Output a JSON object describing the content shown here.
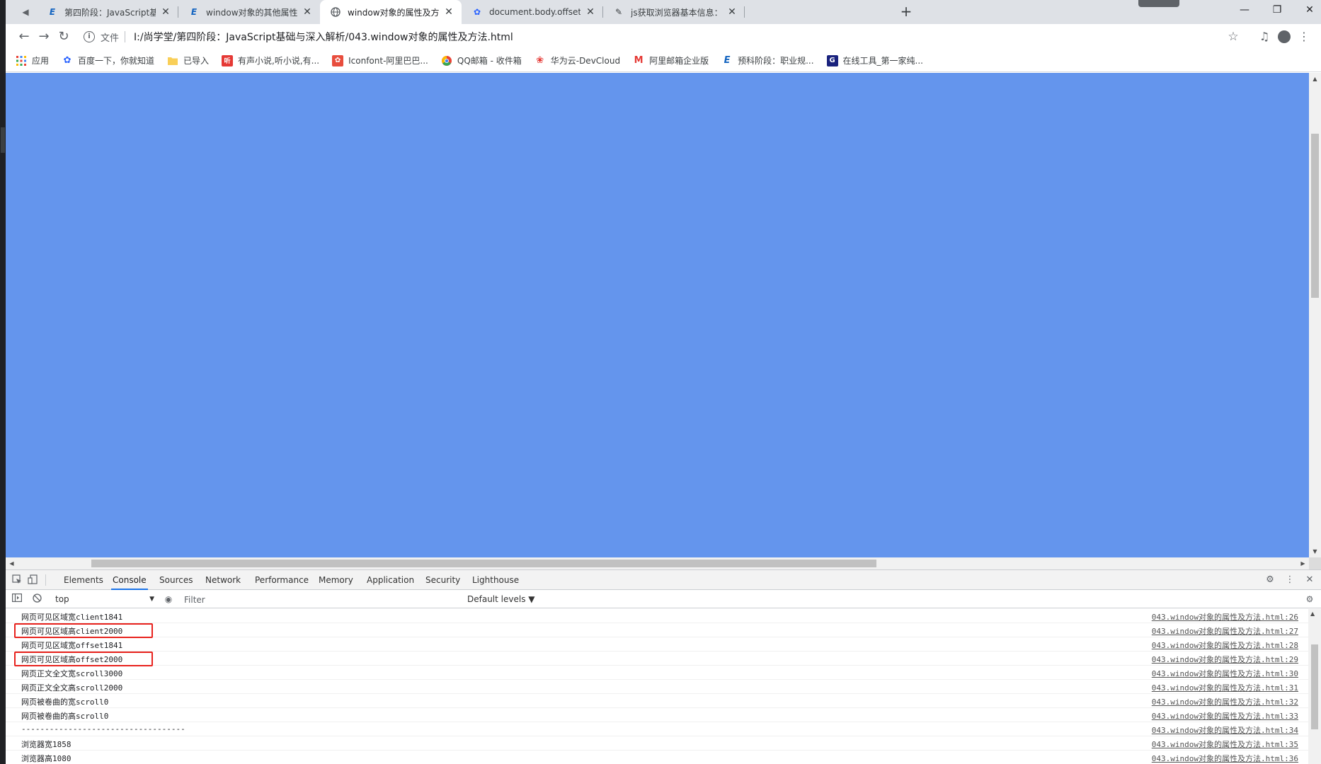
{
  "tabs": [
    {
      "title": "第四阶段：JavaScript基础与深入",
      "favicon": "E",
      "favicon_color": "#1565c0",
      "active": false
    },
    {
      "title": "window对象的其他属性和方法-",
      "favicon": "E",
      "favicon_color": "#1565c0",
      "active": false
    },
    {
      "title": "window对象的属性及方法",
      "favicon": "globe",
      "favicon_color": "#5f6368",
      "active": true
    },
    {
      "title": "document.body.offsetHeight_",
      "favicon": "paw",
      "favicon_color": "#2962ff",
      "active": false
    },
    {
      "title": "js获取浏览器基本信息：docume",
      "favicon": "tool",
      "favicon_color": "#3c4043",
      "active": false
    }
  ],
  "omnibox": {
    "scheme_label": "文件",
    "url": "I:/尚学堂/第四阶段：JavaScript基础与深入解析/043.window对象的属性及方法.html"
  },
  "bookmarks": [
    {
      "label": "应用",
      "icon": "apps-grid-icon",
      "color": "#ea4335"
    },
    {
      "label": "百度一下，你就知道",
      "icon": "paw-icon",
      "color": "#2962ff"
    },
    {
      "label": "已导入",
      "icon": "folder-icon",
      "color": "#f9cf58"
    },
    {
      "label": "有声小说,听小说,有...",
      "icon": "book-icon",
      "color": "#e53935"
    },
    {
      "label": "Iconfont-阿里巴巴...",
      "icon": "iconfont-icon",
      "color": "#e84d3d"
    },
    {
      "label": "QQ邮箱 - 收件箱",
      "icon": "chrome-icon",
      "color": "#fbbc05"
    },
    {
      "label": "华为云-DevCloud",
      "icon": "huawei-icon",
      "color": "#e53935"
    },
    {
      "label": "阿里邮箱企业版",
      "icon": "mail-m-icon",
      "color": "#e53935"
    },
    {
      "label": "预科阶段：职业规...",
      "icon": "edge-e-icon",
      "color": "#1565c0"
    },
    {
      "label": "在线工具_第一家纯...",
      "icon": "g-icon",
      "color": "#1a237e"
    }
  ],
  "page": {
    "background": "#6495ed"
  },
  "devtools": {
    "tabs": [
      "Elements",
      "Console",
      "Sources",
      "Network",
      "Performance",
      "Memory",
      "Application",
      "Security",
      "Lighthouse"
    ],
    "active_tab": "Console",
    "context": "top",
    "filter_placeholder": "Filter",
    "levels_label": "Default levels ▼",
    "logs": [
      {
        "msg": "网页可见区域宽client1841",
        "src": "043.window对象的属性及方法.html:26",
        "highlight": false
      },
      {
        "msg": "网页可见区域高client2000",
        "src": "043.window对象的属性及方法.html:27",
        "highlight": true
      },
      {
        "msg": "网页可见区域宽offset1841",
        "src": "043.window对象的属性及方法.html:28",
        "highlight": false
      },
      {
        "msg": "网页可见区域高offset2000",
        "src": "043.window对象的属性及方法.html:29",
        "highlight": true
      },
      {
        "msg": "网页正文全文宽scroll3000",
        "src": "043.window对象的属性及方法.html:30",
        "highlight": false
      },
      {
        "msg": "网页正文全文高scroll2000",
        "src": "043.window对象的属性及方法.html:31",
        "highlight": false
      },
      {
        "msg": "网页被卷曲的宽scroll0",
        "src": "043.window对象的属性及方法.html:32",
        "highlight": false
      },
      {
        "msg": "网页被卷曲的高scroll0",
        "src": "043.window对象的属性及方法.html:33",
        "highlight": false
      },
      {
        "msg": "-----------------------------------",
        "src": "043.window对象的属性及方法.html:34",
        "highlight": false
      },
      {
        "msg": "浏览器宽1858",
        "src": "043.window对象的属性及方法.html:35",
        "highlight": false
      },
      {
        "msg": "浏览器高1080",
        "src": "043.window对象的属性及方法.html:36",
        "highlight": false
      }
    ]
  }
}
